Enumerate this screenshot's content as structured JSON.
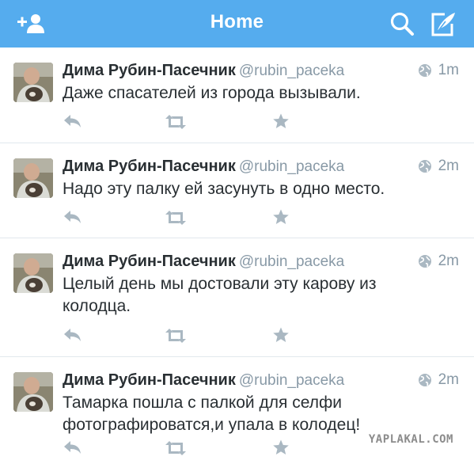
{
  "nav": {
    "title": "Home",
    "add_user_icon": "add-user-icon",
    "search_icon": "search-icon",
    "compose_icon": "compose-icon"
  },
  "colors": {
    "brand": "#55acee",
    "text": "#292f33",
    "secondary": "#8899a6",
    "action": "#aab8c2"
  },
  "tweets": [
    {
      "name": "Дима Рубин-Пасечник",
      "handle": "@rubin_paceka",
      "time": "1m",
      "text": "Даже спасателей из города вызывали."
    },
    {
      "name": "Дима Рубин-Пасечник",
      "handle": "@rubin_paceka",
      "time": "2m",
      "text": "Надо эту палку ей засунуть в одно место."
    },
    {
      "name": "Дима Рубин-Пасечник",
      "handle": "@rubin_paceka",
      "time": "2m",
      "text": "Целый день мы достовали эту карову из колодца."
    },
    {
      "name": "Дима Рубин-Пасечник",
      "handle": "@rubin_paceka",
      "time": "2m",
      "text": "Тамарка пошла с палкой для селфи фотографироватся,и упала в колодец!"
    }
  ],
  "watermark": "YAPLAKAL.COM"
}
